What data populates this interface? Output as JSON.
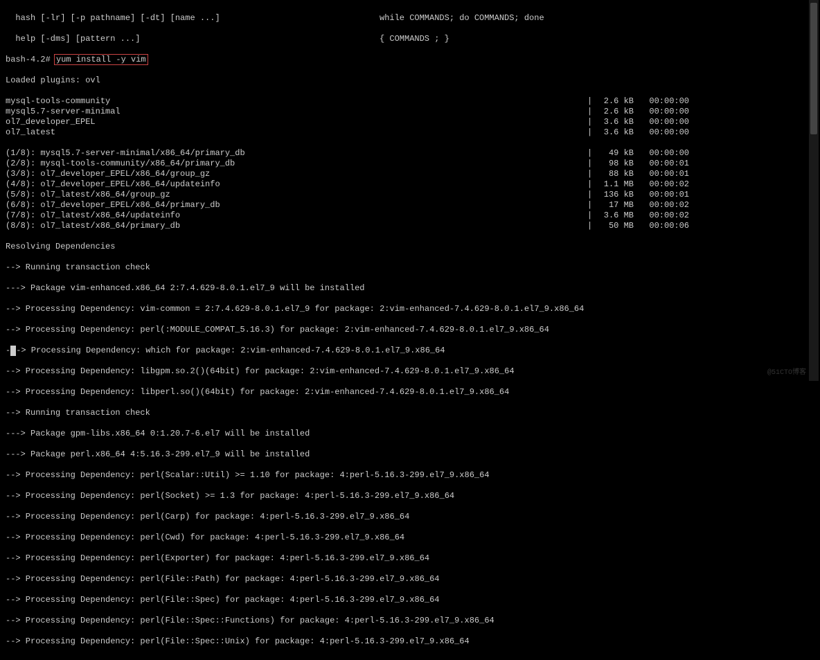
{
  "header": {
    "left1": "  hash [-lr] [-p pathname] [-dt] [name ...]",
    "right1": "while COMMANDS; do COMMANDS; done",
    "left2": "  help [-dms] [pattern ...]",
    "right2": "{ COMMANDS ; }"
  },
  "prompt": {
    "before": "bash-4.2# ",
    "cmd": "yum install -y vim"
  },
  "loaded": "Loaded plugins: ovl",
  "repos": [
    {
      "name": "mysql-tools-community",
      "size": "2.6 kB",
      "time": "00:00:00"
    },
    {
      "name": "mysql5.7-server-minimal",
      "size": "2.6 kB",
      "time": "00:00:00"
    },
    {
      "name": "ol7_developer_EPEL",
      "size": "3.6 kB",
      "time": "00:00:00"
    },
    {
      "name": "ol7_latest",
      "size": "3.6 kB",
      "time": "00:00:00"
    }
  ],
  "downloads": [
    {
      "name": "(1/8): mysql5.7-server-minimal/x86_64/primary_db",
      "size": "49 kB",
      "time": "00:00:00"
    },
    {
      "name": "(2/8): mysql-tools-community/x86_64/primary_db",
      "size": "98 kB",
      "time": "00:00:01"
    },
    {
      "name": "(3/8): ol7_developer_EPEL/x86_64/group_gz",
      "size": "88 kB",
      "time": "00:00:01"
    },
    {
      "name": "(4/8): ol7_developer_EPEL/x86_64/updateinfo",
      "size": "1.1 MB",
      "time": "00:00:02"
    },
    {
      "name": "(5/8): ol7_latest/x86_64/group_gz",
      "size": "136 kB",
      "time": "00:00:01"
    },
    {
      "name": "(6/8): ol7_developer_EPEL/x86_64/primary_db",
      "size": "17 MB",
      "time": "00:00:02"
    },
    {
      "name": "(7/8): ol7_latest/x86_64/updateinfo",
      "size": "3.6 MB",
      "time": "00:00:02"
    },
    {
      "name": "(8/8): ol7_latest/x86_64/primary_db",
      "size": "50 MB",
      "time": "00:00:06"
    }
  ],
  "dep": {
    "resolve": "Resolving Dependencies",
    "check1": "--> Running transaction check",
    "l1": "---> Package vim-enhanced.x86_64 2:7.4.629-8.0.1.el7_9 will be installed",
    "l2": "--> Processing Dependency: vim-common = 2:7.4.629-8.0.1.el7_9 for package: 2:vim-enhanced-7.4.629-8.0.1.el7_9.x86_64",
    "l3": "--> Processing Dependency: perl(:MODULE_COMPAT_5.16.3) for package: 2:vim-enhanced-7.4.629-8.0.1.el7_9.x86_64",
    "l4a": "-",
    "l4b": "-> Processing Dependency: which for package: 2:vim-enhanced-7.4.629-8.0.1.el7_9.x86_64",
    "l5": "--> Processing Dependency: libgpm.so.2()(64bit) for package: 2:vim-enhanced-7.4.629-8.0.1.el7_9.x86_64",
    "l6": "--> Processing Dependency: libperl.so()(64bit) for package: 2:vim-enhanced-7.4.629-8.0.1.el7_9.x86_64",
    "check2": "--> Running transaction check",
    "l7": "---> Package gpm-libs.x86_64 0:1.20.7-6.el7 will be installed",
    "l8": "---> Package perl.x86_64 4:5.16.3-299.el7_9 will be installed",
    "l9": "--> Processing Dependency: perl(Scalar::Util) >= 1.10 for package: 4:perl-5.16.3-299.el7_9.x86_64",
    "l10": "--> Processing Dependency: perl(Socket) >= 1.3 for package: 4:perl-5.16.3-299.el7_9.x86_64",
    "l11": "--> Processing Dependency: perl(Carp) for package: 4:perl-5.16.3-299.el7_9.x86_64",
    "l12": "--> Processing Dependency: perl(Cwd) for package: 4:perl-5.16.3-299.el7_9.x86_64",
    "l13": "--> Processing Dependency: perl(Exporter) for package: 4:perl-5.16.3-299.el7_9.x86_64",
    "l14": "--> Processing Dependency: perl(File::Path) for package: 4:perl-5.16.3-299.el7_9.x86_64",
    "l15": "--> Processing Dependency: perl(File::Spec) for package: 4:perl-5.16.3-299.el7_9.x86_64",
    "l16": "--> Processing Dependency: perl(File::Spec::Functions) for package: 4:perl-5.16.3-299.el7_9.x86_64",
    "l17": "--> Processing Dependency: perl(File::Spec::Unix) for package: 4:perl-5.16.3-299.el7_9.x86_64"
  },
  "watermark": "@51CTO博客"
}
